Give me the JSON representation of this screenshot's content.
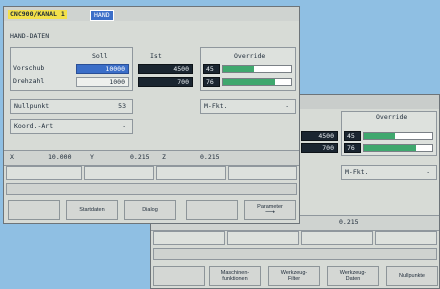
{
  "front": {
    "title": "CNC900/KANAL 1",
    "mode": "HAND",
    "section": "HAND-DATEN",
    "soll_header": "Soll",
    "ist_header": "Ist",
    "override_header": "Override",
    "rows": [
      {
        "label": "Vorschub",
        "soll": "10000",
        "ist": "4500",
        "ov": "45",
        "ov_fill": 0.45
      },
      {
        "label": "Drehzahl",
        "soll": "1000",
        "ist": "700",
        "ov": "76",
        "ov_fill": 0.76
      }
    ],
    "nullpunkt_label": "Nullpunkt",
    "nullpunkt_value": "53",
    "koord_label": "Koord.-Art",
    "koord_value": "-",
    "mfkt_label": "M-Fkt.",
    "mfkt_value": "-",
    "coords": [
      {
        "axis": "X",
        "value": "10.000"
      },
      {
        "axis": "Y",
        "value": "0.215"
      },
      {
        "axis": "Z",
        "value": "0.215"
      }
    ],
    "softkeys": [
      "",
      "Startdaten",
      "Dialog",
      "",
      "Parameter"
    ]
  },
  "back": {
    "override_header": "Override",
    "ist_values": [
      "4500",
      "700"
    ],
    "ov_values": [
      "45",
      "76"
    ],
    "ov_fills": [
      0.45,
      0.76
    ],
    "mfkt_label": "M-Fkt.",
    "mfkt_value": "-",
    "coord_value": "0.215",
    "softkeys": [
      "",
      "Maschinen-\nfunktionen",
      "Werkzeug-\nFilter",
      "Werkzeug-\nDaten",
      "Nullpunkte"
    ]
  },
  "colors": {
    "background": "#8fbfe3",
    "title_badge": "#f3e04a",
    "mode_badge": "#3b6ec8",
    "override_fill": "#3fa86e",
    "dark_value": "#1a2530"
  }
}
